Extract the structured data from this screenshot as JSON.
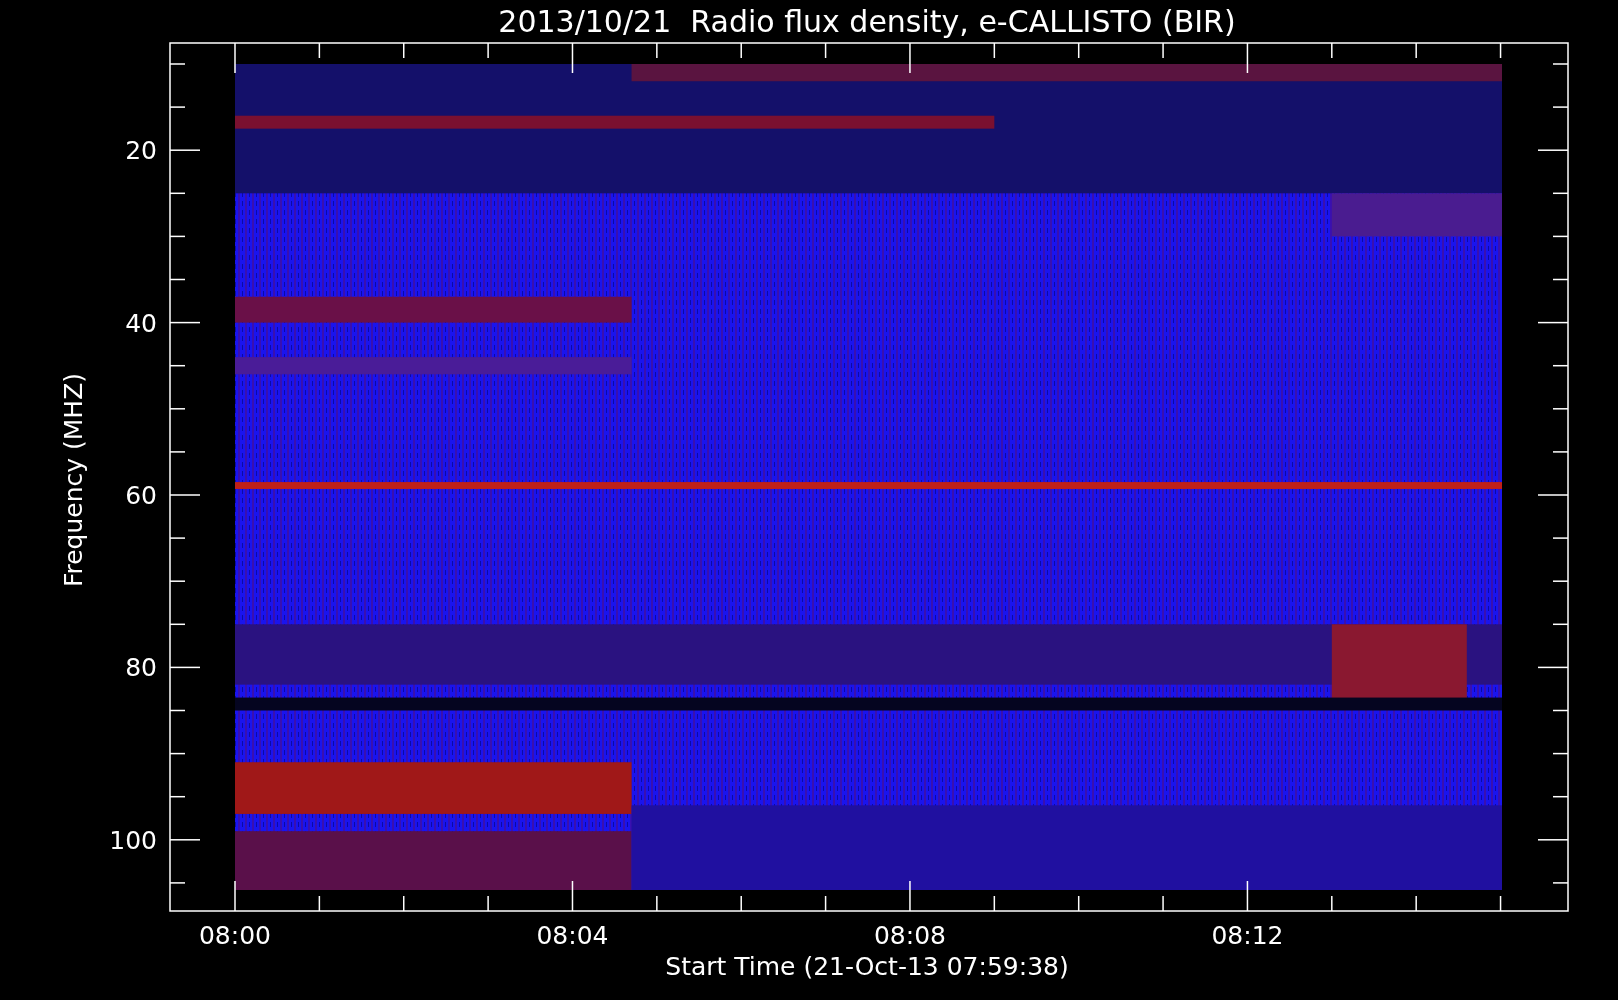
{
  "title": "2013/10/21  Radio flux density, e-CALLISTO (BIR)",
  "y_axis": {
    "label": "Frequency (MHZ)",
    "ticks": [
      "20",
      "40",
      "60",
      "80",
      "100"
    ]
  },
  "x_axis": {
    "label": "Start Time (21-Oct-13 07:59:38)",
    "ticks": [
      "08:00",
      "08:04",
      "08:08",
      "08:12"
    ]
  }
}
